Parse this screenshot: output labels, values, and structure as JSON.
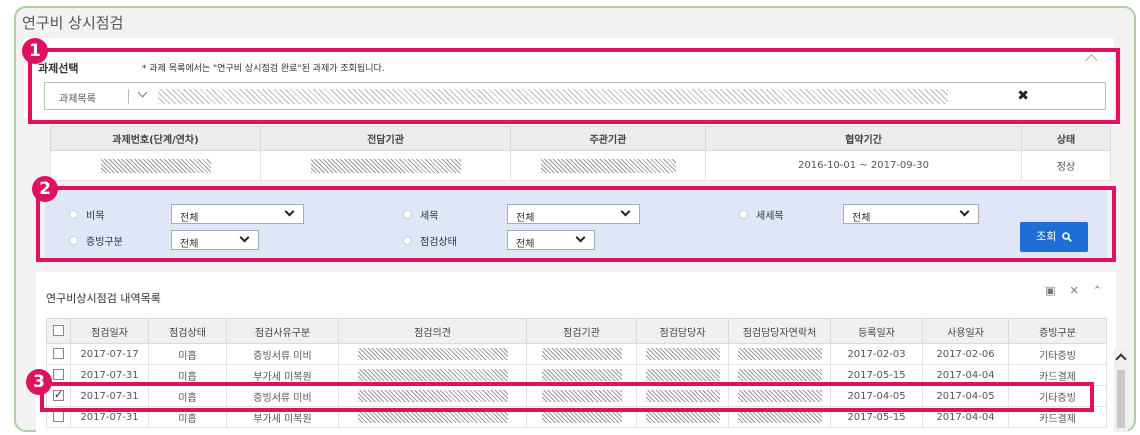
{
  "page": {
    "title": "연구비 상시점검"
  },
  "markers": [
    "1",
    "2",
    "3"
  ],
  "project": {
    "label": "과제선택",
    "note": "* 과제 목록에서는 \"연구비 상시점검 완료\"된 과제가 조회됩니다.",
    "select_label": "과제목록",
    "clear_icon": "✖"
  },
  "info_table": {
    "headers": [
      "과제번호(단계/연차)",
      "전담기관",
      "주관기관",
      "협약기간",
      "상태"
    ],
    "row": {
      "period": "2016-10-01 ~ 2017-09-30",
      "status": "정상"
    }
  },
  "search": {
    "fields": [
      {
        "label": "비목",
        "value": "전체"
      },
      {
        "label": "세목",
        "value": "전체"
      },
      {
        "label": "세세목",
        "value": "전체"
      },
      {
        "label": "증빙구분",
        "value": "전체"
      },
      {
        "label": "점검상태",
        "value": "전체"
      }
    ],
    "button": "조회"
  },
  "list": {
    "title": "연구비상시점검 내역목록",
    "tools": [
      "▣",
      "✕",
      "⌃"
    ],
    "headers": [
      "점검일자",
      "점검상태",
      "점검사유구분",
      "점검의견",
      "점검기관",
      "점검담당자",
      "점검담당자연락처",
      "등록일자",
      "사용일자",
      "증빙구분"
    ],
    "rows": [
      {
        "checked": false,
        "date": "2017-07-17",
        "state": "미흡",
        "reason": "증빙서류 미비",
        "reg": "2017-02-03",
        "use": "2017-02-06",
        "proof": "기타증빙"
      },
      {
        "checked": false,
        "date": "2017-07-31",
        "state": "미흡",
        "reason": "부가세 미복원",
        "reg": "2017-05-15",
        "use": "2017-04-04",
        "proof": "카드결제"
      },
      {
        "checked": true,
        "date": "2017-07-31",
        "state": "미흡",
        "reason": "증빙서류 미비",
        "reg": "2017-04-05",
        "use": "2017-04-05",
        "proof": "기타증빙"
      },
      {
        "checked": false,
        "date": "2017-07-31",
        "state": "미흡",
        "reason": "부가세 미복원",
        "reg": "2017-05-15",
        "use": "2017-04-04",
        "proof": "카드결제"
      }
    ]
  },
  "colors": {
    "highlight": "#e0115f",
    "search_panel": "#dfe6f8",
    "button": "#1d6fd6",
    "frame": "#a9d39c"
  }
}
